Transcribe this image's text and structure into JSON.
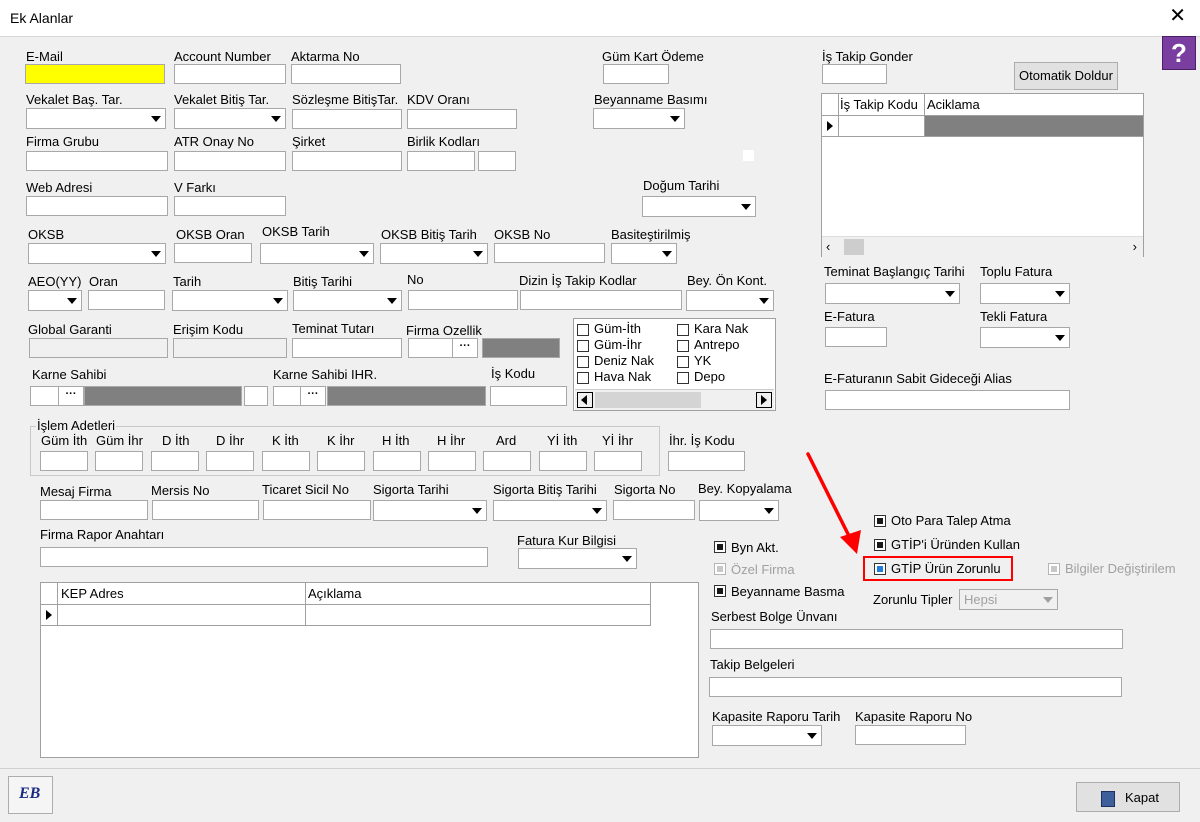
{
  "window": {
    "title": "Ek Alanlar",
    "close": "✕",
    "help": "?"
  },
  "labels": {
    "email": "E-Mail",
    "account_number": "Account Number",
    "aktarma_no": "Aktarma No",
    "gum_kart_odeme": "Güm Kart Ödeme",
    "is_takip_gonder": "İş Takip Gonder",
    "vekalet_bas": "Vekalet Baş. Tar.",
    "vekalet_bitis": "Vekalet Bitiş Tar.",
    "sozlesme_bitis": "Sözleşme BitişTar.",
    "kdv_orani": "KDV Oranı",
    "beyanname_basimi": "Beyanname Basımı",
    "firma_grubu": "Firma Grubu",
    "atr_onay_no": "ATR Onay No",
    "sirket": "Şirket",
    "birlik_kodlari": "Birlik Kodları",
    "web_adresi": "Web Adresi",
    "v_farki": "V Farkı",
    "dogum_tarihi": "Doğum Tarihi",
    "oksb": "OKSB",
    "oksb_oran": "OKSB Oran",
    "oksb_tarih": "OKSB Tarih",
    "oksb_bitis": "OKSB Bitiş Tarih",
    "oksb_no": "OKSB No",
    "basitestirilmis": "Basiteştirilmiş",
    "aeo": "AEO(YY)",
    "oran": "Oran",
    "tarih": "Tarih",
    "bitis_tarihi": "Bitiş Tarihi",
    "no": "No",
    "dizin_is_takip": "Dizin İş Takip Kodlar",
    "bey_on_kont": "Bey. Ön Kont.",
    "global_garanti": "Global Garanti",
    "erisim_kodu": "Erişim Kodu",
    "teminat_tutari": "Teminat Tutarı",
    "firma_ozellik": "Firma Ozellik",
    "karne_sahibi": "Karne Sahibi",
    "karne_sahibi_ihr": "Karne Sahibi IHR.",
    "is_kodu": "İş Kodu",
    "islem_adetleri": "İşlem Adetleri",
    "ihr_is_kodu": "İhr. İş Kodu",
    "mesaj_firma": "Mesaj Firma",
    "mersis_no": "Mersis No",
    "ticaret_sicil": "Ticaret Sicil No",
    "sigorta_tarihi": "Sigorta Tarihi",
    "sigorta_bitis": "Sigorta Bitiş Tarihi",
    "sigorta_no": "Sigorta No",
    "bey_kopyalama": "Bey. Kopyalama",
    "firma_rapor": "Firma Rapor Anahtarı",
    "fatura_kur": "Fatura Kur Bilgisi",
    "teminat_baslangic": "Teminat Başlangıç Tarihi",
    "toplu_fatura": "Toplu Fatura",
    "e_fatura": "E-Fatura",
    "tekli_fatura": "Tekli Fatura",
    "e_fatura_alias": "E-Faturanın Sabit Gideceği Alias",
    "zorunlu_tipler": "Zorunlu Tipler",
    "serbest_bolge": "Serbest Bolge Ünvanı",
    "takip_belgeleri": "Takip Belgeleri",
    "kapasite_tarih": "Kapasite Raporu Tarih",
    "kapasite_no": "Kapasite Raporu No"
  },
  "islem_cols": [
    "Güm İth",
    "Güm İhr",
    "D İth",
    "D İhr",
    "K İth",
    "K İhr",
    "H İth",
    "H İhr",
    "Ard",
    "Yİ İth",
    "Yİ İhr"
  ],
  "checklist": {
    "left": [
      "Güm-İth",
      "Güm-İhr",
      "Deniz Nak",
      "Hava Nak"
    ],
    "right": [
      "Kara Nak",
      "Antrepo",
      "YK",
      "Depo"
    ]
  },
  "is_takip_grid": {
    "col1": "İş Takip Kodu",
    "col2": "Aciklama"
  },
  "kep_grid": {
    "col1": "KEP Adres",
    "col2": "Açıklama"
  },
  "checks": {
    "oto_para": "Oto Para Talep Atma",
    "gtip_urunden": "GTİP'i Üründen Kullan",
    "gtip_zorunlu": "GTİP Ürün Zorunlu",
    "bilgiler": "Bilgiler Değiştirilem",
    "byn_akt": "Byn Akt.",
    "ozel_firma": "Özel Firma",
    "beyanname_basma": "Beyanname Basma"
  },
  "zorunlu_tipler_value": "Hepsi",
  "buttons": {
    "otomatik_doldur": "Otomatik Doldur",
    "kapat": "Kapat",
    "logo": "EB"
  },
  "colors": {
    "highlight": "#ff0000",
    "email_bg": "#ffff00",
    "checked_blue": "#1e7fe0"
  }
}
